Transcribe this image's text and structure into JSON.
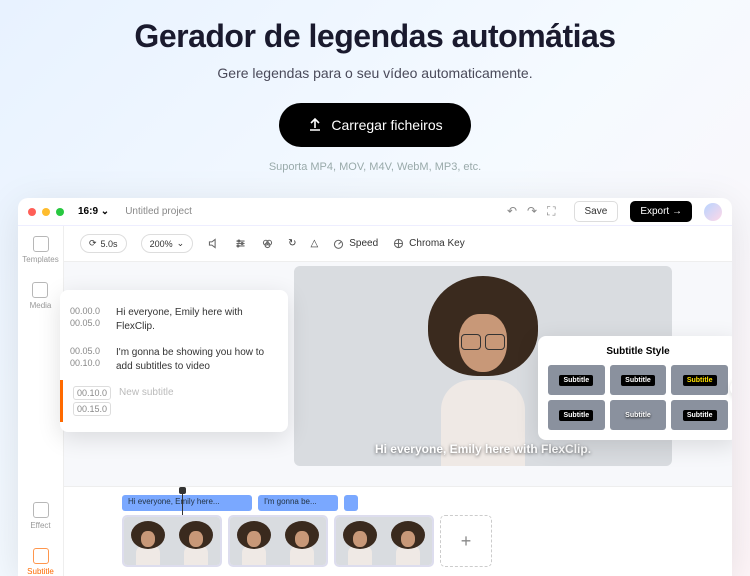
{
  "hero": {
    "title": "Gerador de legendas automátias",
    "subtitle": "Gere legendas para o seu vídeo automaticamente.",
    "upload": "Carregar ficheiros",
    "support": "Suporta MP4, MOV, M4V, WebM, MP3, etc."
  },
  "app": {
    "ratio": "16:9",
    "project": "Untitled project",
    "save": "Save",
    "export": "Export →"
  },
  "sidebar": {
    "items": [
      "Templates",
      "Media",
      "Effect",
      "Subtitle"
    ]
  },
  "toolbar": {
    "duration": "5.0s",
    "zoom": "200%",
    "speed": "Speed",
    "chroma": "Chroma Key"
  },
  "subtitles": [
    {
      "start": "00.00.0",
      "end": "00.05.0",
      "text": "Hi everyone, Emily here with FlexClip."
    },
    {
      "start": "00.05.0",
      "end": "00.10.0",
      "text": "I'm gonna be showing you how to add subtitles to video"
    },
    {
      "start": "00.10.0",
      "end": "00.15.0",
      "text": ""
    }
  ],
  "subtitle_placeholder": "New subtitle",
  "caption": "Hi everyone, Emily here with FlexClip.",
  "styles": {
    "title": "Subtitle Style",
    "label": "Subtitle"
  },
  "timeline": {
    "clips": [
      "Hi everyone, Emily here...",
      "I'm gonna be...",
      ""
    ]
  },
  "add_label": "+"
}
